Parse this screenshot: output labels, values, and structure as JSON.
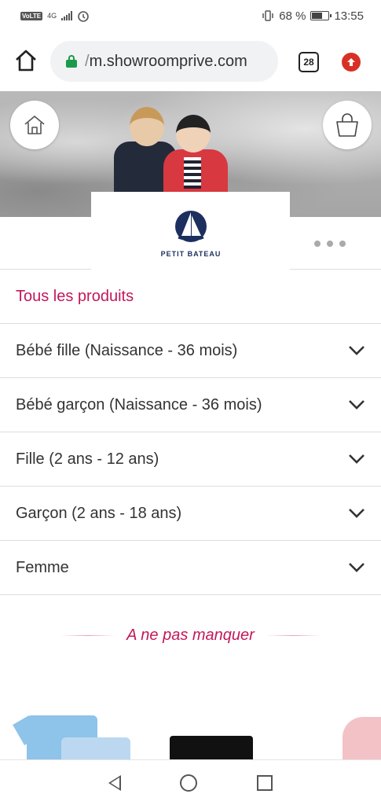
{
  "status_bar": {
    "network": "VoLTE",
    "signal": "4G",
    "battery_percent": "68 %",
    "battery_level": 0.68,
    "time": "13:55"
  },
  "browser": {
    "url_prefix": "/",
    "url": "m.showroomprive.com",
    "tab_count": "28",
    "icons": {
      "home": "home-icon",
      "lock": "lock-icon",
      "update": "update-arrow-icon"
    }
  },
  "hero": {
    "icons": {
      "home": "home-outline-icon",
      "cart": "shopping-bag-icon"
    }
  },
  "brand": {
    "logo_text": "PETIT BATEAU",
    "more": "more-dots-icon"
  },
  "categories": [
    {
      "label": "Tous les produits",
      "expandable": false
    },
    {
      "label": "Bébé fille (Naissance - 36 mois)",
      "expandable": true
    },
    {
      "label": "Bébé garçon (Naissance - 36 mois)",
      "expandable": true
    },
    {
      "label": "Fille (2 ans - 12 ans)",
      "expandable": true
    },
    {
      "label": "Garçon (2 ans - 18 ans)",
      "expandable": true
    },
    {
      "label": "Femme",
      "expandable": true
    }
  ],
  "promo": {
    "title": "A ne pas manquer"
  },
  "colors": {
    "accent": "#c2185b",
    "brand_navy": "#1c2f5e",
    "lock_green": "#1a9a4a",
    "update_red": "#d93025"
  }
}
